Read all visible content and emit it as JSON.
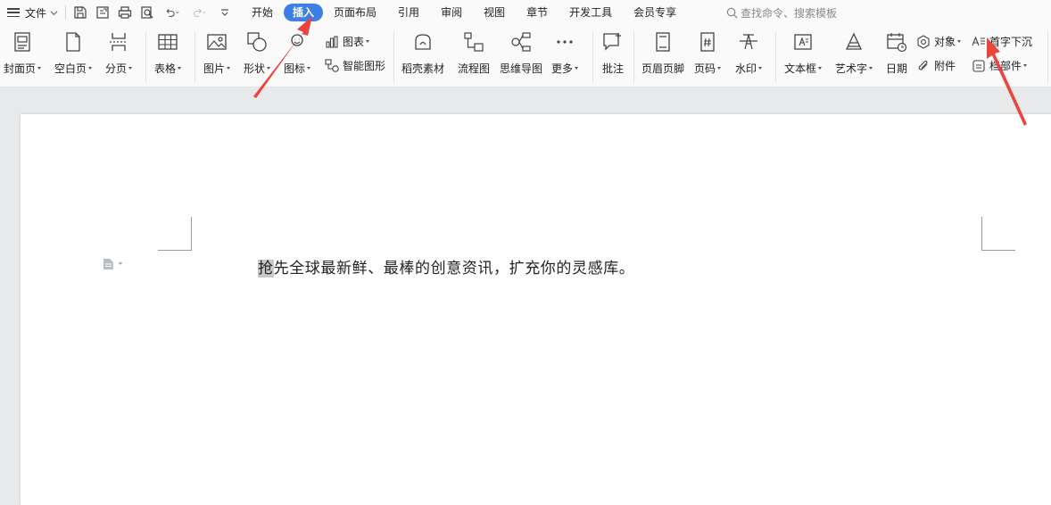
{
  "menubar": {
    "file_label": "文件",
    "tabs": [
      {
        "label": "开始"
      },
      {
        "label": "插入",
        "active": true
      },
      {
        "label": "页面布局"
      },
      {
        "label": "引用"
      },
      {
        "label": "审阅"
      },
      {
        "label": "视图"
      },
      {
        "label": "章节"
      },
      {
        "label": "开发工具"
      },
      {
        "label": "会员专享"
      }
    ],
    "search_placeholder": "查找命令、搜索模板"
  },
  "ribbon": {
    "cover_page": "封面页",
    "blank_page": "空白页",
    "page_break": "分页",
    "table": "表格",
    "picture": "图片",
    "shape": "形状",
    "icon": "图标",
    "chart": "图表",
    "smart_art": "智能图形",
    "straw_assets": "稻壳素材",
    "flowchart": "流程图",
    "mind_map": "思维导图",
    "more": "更多",
    "comment": "批注",
    "header_footer": "页眉页脚",
    "page_number": "页码",
    "watermark": "水印",
    "text_box": "文本框",
    "word_art": "艺术字",
    "date": "日期",
    "object": "对象",
    "attachment": "附件",
    "drop_cap": "首字下沉",
    "doc_parts": "档部件"
  },
  "document": {
    "first_char": "抢",
    "rest_text": "先全球最新鲜、最棒的创意资讯，扩充你的灵感库。"
  },
  "colors": {
    "accent": "#3d7fe6",
    "arrow": "#e8453c"
  }
}
